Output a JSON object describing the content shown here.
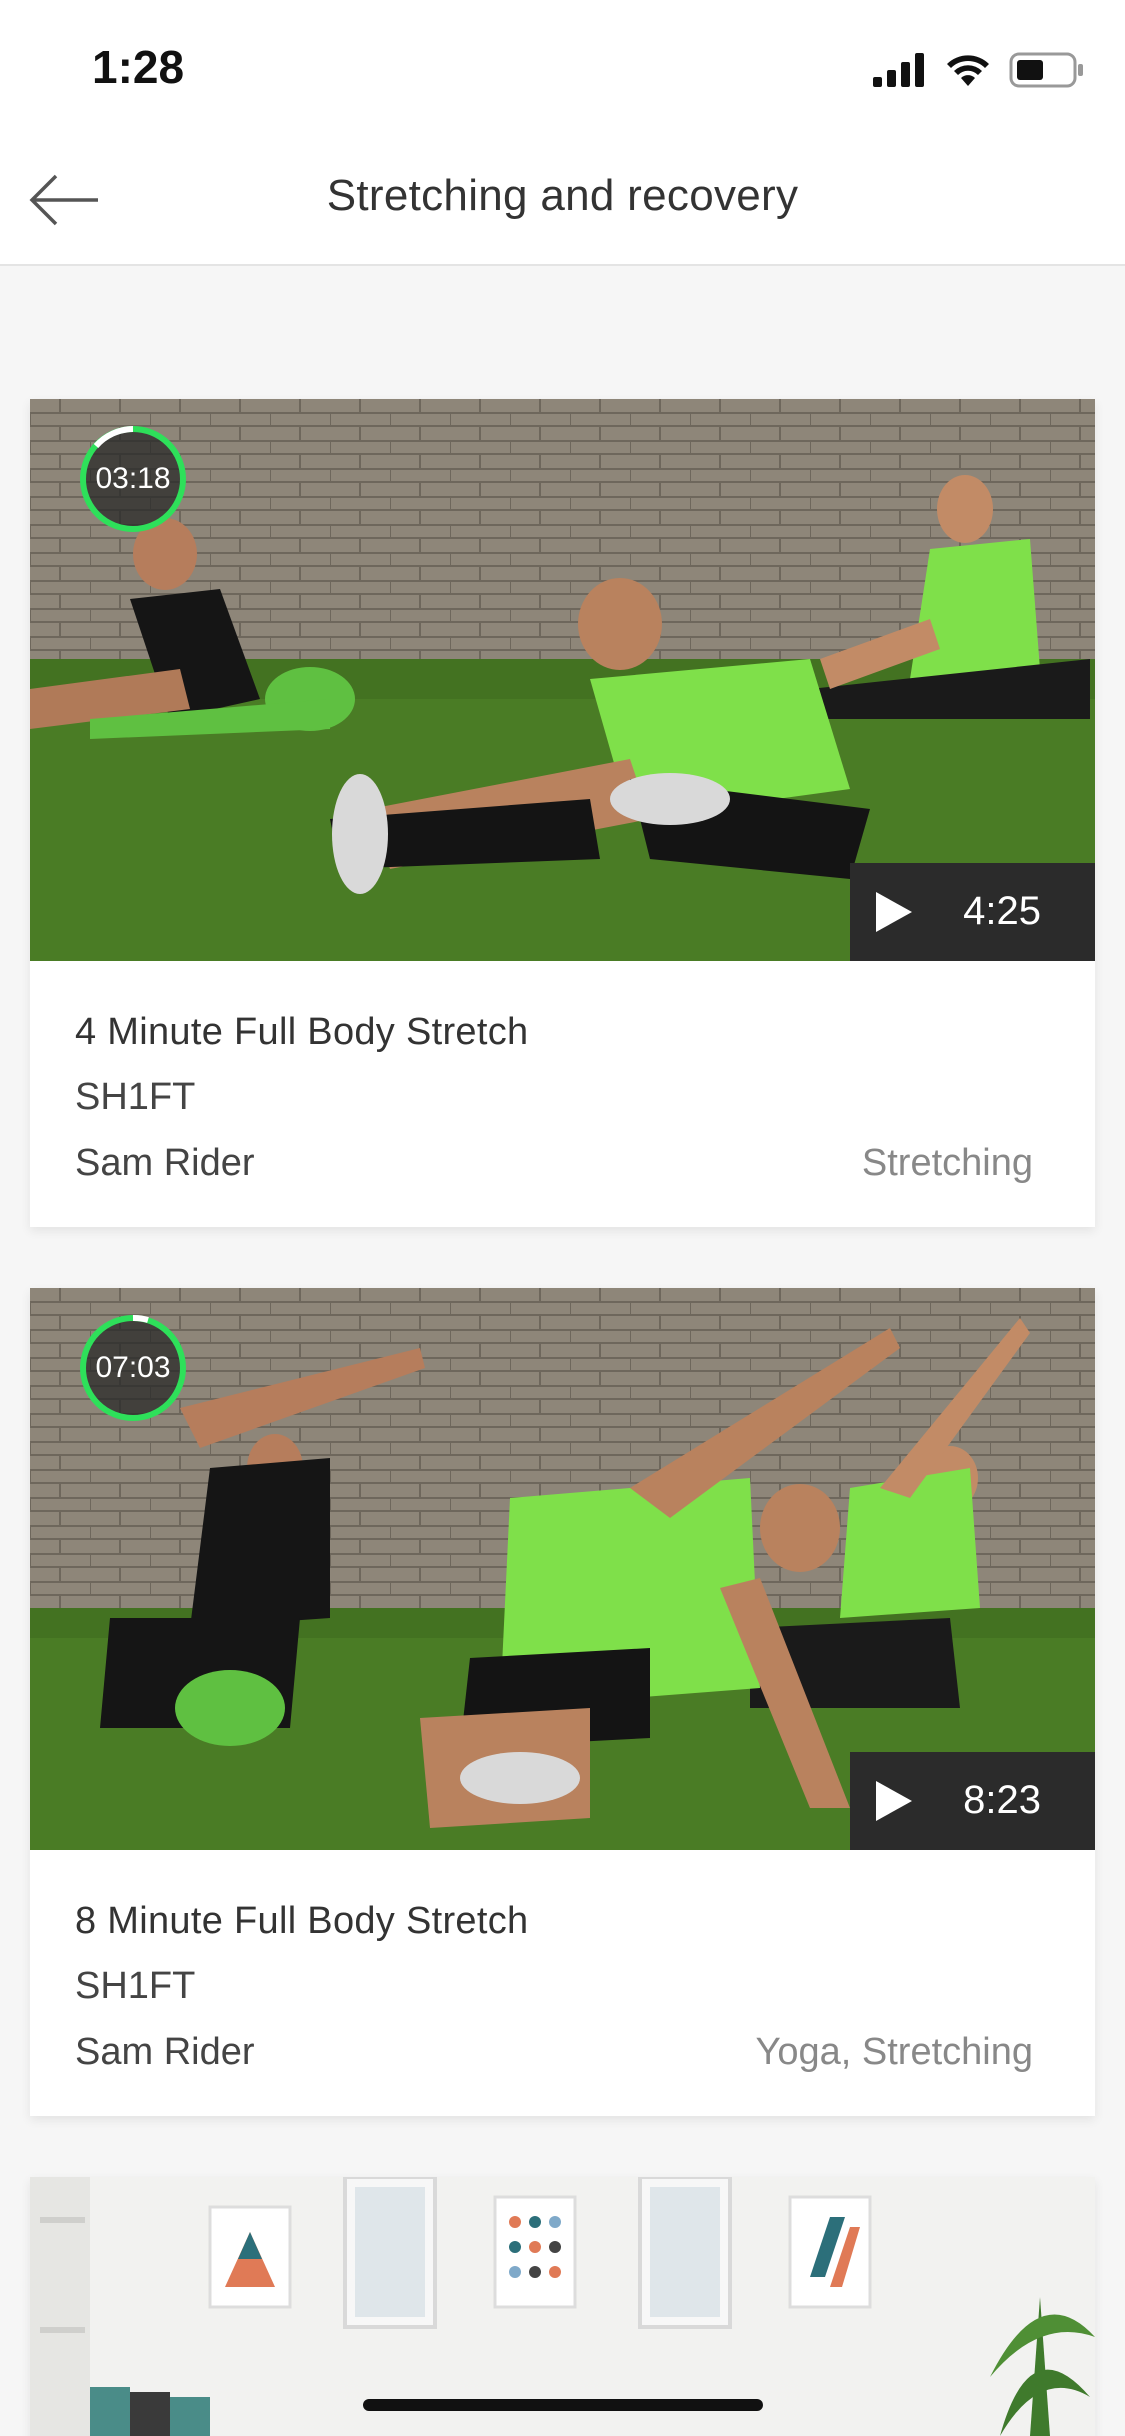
{
  "status_bar": {
    "time": "1:28"
  },
  "header": {
    "back_icon": "arrow-left-icon",
    "title": "Stretching and recovery"
  },
  "videos": [
    {
      "timer": "03:18",
      "duration": "4:25",
      "title": "4 Minute Full Body Stretch",
      "brand": "SH1FT",
      "trainer": "Sam Rider",
      "tags": "Stretching"
    },
    {
      "timer": "07:03",
      "duration": "8:23",
      "title": "8 Minute Full Body Stretch",
      "brand": "SH1FT",
      "trainer": "Sam Rider",
      "tags": "Yoga, Stretching"
    }
  ],
  "colors": {
    "accent": "#2ee05a",
    "badge_bg": "#2b2b2b",
    "turf": "#4c7d26",
    "brick": "#8d8577",
    "shirt_green": "#7fe04a"
  }
}
